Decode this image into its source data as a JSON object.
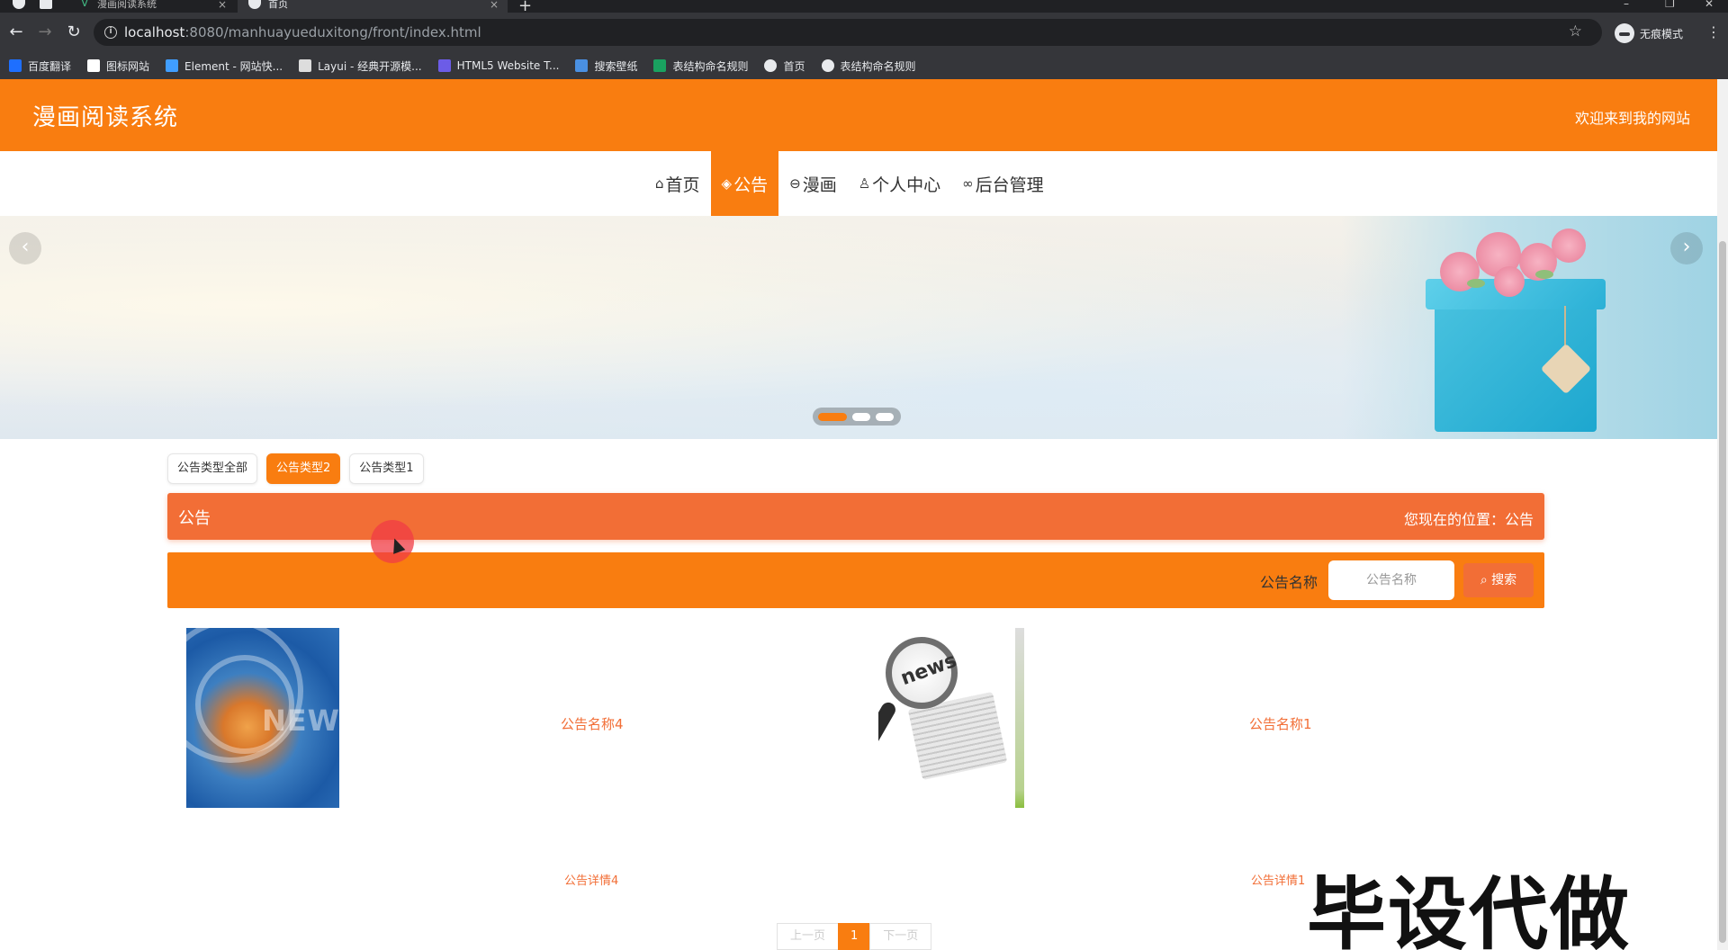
{
  "browser": {
    "tabs": [
      {
        "title": "漫画阅读系统",
        "active": false
      },
      {
        "title": "首页",
        "active": true
      }
    ],
    "url_host": "localhost",
    "url_rest": ":8080/manhuayueduxitong/front/index.html",
    "profile_label": "无痕模式",
    "bookmarks": [
      {
        "label": "百度翻译",
        "icon": "translate-icon",
        "color": "#1e6fff"
      },
      {
        "label": "图标网站",
        "icon": "flag-icon",
        "color": "#ffffff"
      },
      {
        "label": "Element - 网站快...",
        "icon": "element-icon",
        "color": "#409eff"
      },
      {
        "label": "Layui - 经典开源模...",
        "icon": "layui-icon",
        "color": "#dddddd"
      },
      {
        "label": "HTML5 Website T...",
        "icon": "html5-icon",
        "color": "#6c5ce7"
      },
      {
        "label": "搜索壁纸",
        "icon": "wallpaper-icon",
        "color": "#4a90e2"
      },
      {
        "label": "表结构命名规则",
        "icon": "sheet-icon",
        "color": "#1aa260"
      },
      {
        "label": "首页",
        "icon": "globe-icon",
        "color": "#e8eaed"
      },
      {
        "label": "表结构命名规则",
        "icon": "globe-icon",
        "color": "#e8eaed"
      }
    ]
  },
  "header": {
    "site_title": "漫画阅读系统",
    "welcome": "欢迎来到我的网站"
  },
  "nav": {
    "items": [
      {
        "label": "首页",
        "icon": "home-icon",
        "glyph": "⌂",
        "active": false
      },
      {
        "label": "公告",
        "icon": "layers-icon",
        "glyph": "◈",
        "active": true
      },
      {
        "label": "漫画",
        "icon": "printer-icon",
        "glyph": "⊖",
        "active": false
      },
      {
        "label": "个人中心",
        "icon": "user-icon",
        "glyph": "♙",
        "active": false
      },
      {
        "label": "后台管理",
        "icon": "link-icon",
        "glyph": "∞",
        "active": false
      }
    ]
  },
  "banner": {
    "slide_count": 3,
    "active_slide": 1
  },
  "filters": [
    {
      "label": "公告类型全部",
      "active": false
    },
    {
      "label": "公告类型2",
      "active": true
    },
    {
      "label": "公告类型1",
      "active": false
    }
  ],
  "section": {
    "title": "公告",
    "location": "您现在的位置：公告"
  },
  "search": {
    "label": "公告名称",
    "placeholder": "公告名称",
    "button": "搜索"
  },
  "cards": [
    {
      "title": "公告名称4",
      "detail": "公告详情4",
      "image": "news-globe-image"
    },
    {
      "title": "公告名称1",
      "detail": "公告详情1",
      "image": "magnifier-newspaper-image"
    }
  ],
  "pager": {
    "prev": "上一页",
    "current": "1",
    "next": "下一页"
  },
  "watermark": "毕设代做",
  "colors": {
    "primary": "#f97d10",
    "accent": "#f26e36"
  }
}
